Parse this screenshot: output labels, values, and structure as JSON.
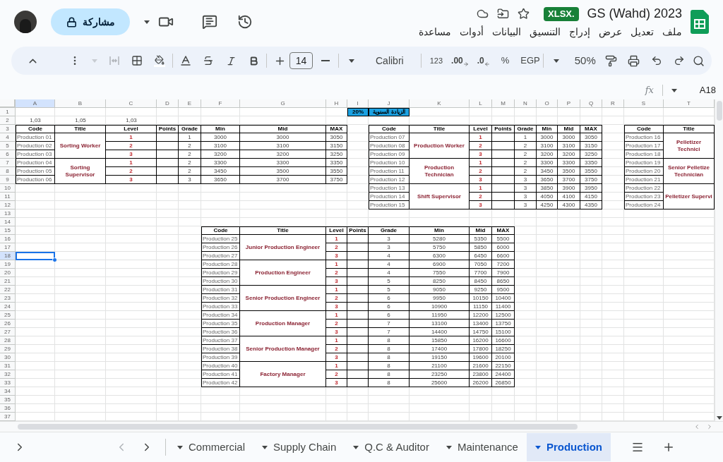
{
  "header": {
    "title": "GS (Wahd) 2023",
    "file_badge": "XLSX.",
    "share_label": "مشاركة",
    "menu": [
      "ملف",
      "تعديل",
      "عرض",
      "إدراج",
      "التنسيق",
      "البيانات",
      "أدوات",
      "مساعدة"
    ]
  },
  "toolbar": {
    "zoom": "50%",
    "currency": "EGP",
    "percent": "%",
    "decimal_more": ".00",
    "decimal_less": ".0",
    "number_format": "123",
    "font": "Calibri",
    "font_size": "14"
  },
  "formula_bar": {
    "fx": "fx",
    "name_box": "A18"
  },
  "grid": {
    "columns": [
      "A",
      "B",
      "C",
      "D",
      "E",
      "F",
      "G",
      "H",
      "I",
      "J",
      "K",
      "L",
      "M",
      "N",
      "O",
      "P",
      "Q",
      "R",
      "S",
      "T"
    ],
    "rows": [
      "1",
      "2",
      "3",
      "4",
      "5",
      "6",
      "7",
      "8",
      "9",
      "10",
      "11",
      "12",
      "13",
      "14",
      "15",
      "16",
      "17",
      "18",
      "19",
      "20",
      "21",
      "22",
      "23",
      "24",
      "25",
      "26",
      "27",
      "28",
      "29",
      "30",
      "31",
      "32",
      "33",
      "34",
      "35",
      "36",
      "37"
    ],
    "cells": [
      {
        "text": "20%",
        "kind": "highlight"
      },
      {
        "text": "الزيادة السنوية",
        "kind": "highlight"
      },
      {
        "text": "1,03",
        "kind": "plain"
      },
      {
        "text": "1,05",
        "kind": "plain"
      },
      {
        "text": "1,03",
        "kind": "plain"
      }
    ],
    "tables": [
      {
        "columns": [
          "Code",
          "Title",
          "Level",
          "Points",
          "Grade",
          "Min",
          "Mid",
          "MAX"
        ],
        "groups": [
          {
            "title": "Sorting Worker",
            "rows": [
              [
                "Production 01",
                "1",
                "1",
                "3000",
                "3000",
                "3050"
              ],
              [
                "Production 02",
                "2",
                "2",
                "3100",
                "3100",
                "3150"
              ],
              [
                "Production 03",
                "3",
                "2",
                "3200",
                "3200",
                "3250"
              ]
            ]
          },
          {
            "title": "Sorting Supervisor",
            "rows": [
              [
                "Production 04",
                "1",
                "2",
                "3300",
                "3300",
                "3350"
              ],
              [
                "Production 05",
                "2",
                "2",
                "3450",
                "3500",
                "3550"
              ],
              [
                "Production 06",
                "3",
                "3",
                "3650",
                "3700",
                "3750"
              ]
            ]
          }
        ]
      },
      {
        "columns": [
          "Code",
          "Title",
          "Level",
          "Points",
          "Grade",
          "Min",
          "Mid",
          "MAX"
        ],
        "groups": [
          {
            "title": "Production Worker",
            "rows": [
              [
                "Production 07",
                "1",
                "1",
                "3000",
                "3000",
                "3050"
              ],
              [
                "Production 08",
                "2",
                "2",
                "3100",
                "3100",
                "3150"
              ],
              [
                "Production 09",
                "3",
                "2",
                "3200",
                "3200",
                "3250"
              ]
            ]
          },
          {
            "title": "Production Technician",
            "rows": [
              [
                "Production 10",
                "1",
                "2",
                "3300",
                "3300",
                "3350"
              ],
              [
                "Production 11",
                "2",
                "2",
                "3450",
                "3500",
                "3550"
              ],
              [
                "Production 12",
                "3",
                "3",
                "3650",
                "3700",
                "3750"
              ]
            ]
          },
          {
            "title": "Shift Supervisor",
            "rows": [
              [
                "Production 13",
                "1",
                "3",
                "3850",
                "3900",
                "3950"
              ],
              [
                "Production 14",
                "2",
                "3",
                "4050",
                "4100",
                "4150"
              ],
              [
                "Production 15",
                "3",
                "3",
                "4250",
                "4300",
                "4350"
              ]
            ]
          }
        ]
      },
      {
        "columns": [
          "Code",
          "Title"
        ],
        "groups": [
          {
            "title": "Pelletizer Technici",
            "rows": [
              [
                "Production 16"
              ],
              [
                "Production 17"
              ],
              [
                "Production 18"
              ]
            ]
          },
          {
            "title": "Senior Pelletize Technician",
            "rows": [
              [
                "Production 19"
              ],
              [
                "Production 20"
              ],
              [
                "Production 21"
              ]
            ]
          },
          {
            "title": "Pelletizer Supervi",
            "rows": [
              [
                "Production 22"
              ],
              [
                "Production 23"
              ],
              [
                "Production 24"
              ]
            ]
          }
        ]
      },
      {
        "columns": [
          "Code",
          "Title",
          "Level",
          "Points",
          "Grade",
          "Min",
          "Mid",
          "MAX"
        ],
        "groups": [
          {
            "title": "Junior Production Engineer",
            "rows": [
              [
                "Production 25",
                "1",
                "3",
                "5280",
                "5350",
                "5500"
              ],
              [
                "Production 26",
                "2",
                "3",
                "5750",
                "5850",
                "6000"
              ],
              [
                "Production 27",
                "3",
                "4",
                "6300",
                "6450",
                "6600"
              ]
            ]
          },
          {
            "title": "Production Engineer",
            "rows": [
              [
                "Production 28",
                "1",
                "4",
                "6900",
                "7050",
                "7200"
              ],
              [
                "Production 29",
                "2",
                "4",
                "7550",
                "7700",
                "7900"
              ],
              [
                "Production 30",
                "3",
                "5",
                "8250",
                "8450",
                "8650"
              ]
            ]
          },
          {
            "title": "Senior Production Engineer",
            "rows": [
              [
                "Production 31",
                "1",
                "5",
                "9050",
                "9250",
                "9500"
              ],
              [
                "Production 32",
                "2",
                "6",
                "9950",
                "10150",
                "10400"
              ],
              [
                "Production 33",
                "3",
                "6",
                "10900",
                "11150",
                "11400"
              ]
            ]
          },
          {
            "title": "Production Manager",
            "rows": [
              [
                "Production 34",
                "1",
                "6",
                "11950",
                "12200",
                "12500"
              ],
              [
                "Production 35",
                "2",
                "7",
                "13100",
                "13400",
                "13750"
              ],
              [
                "Production 36",
                "3",
                "7",
                "14400",
                "14750",
                "15100"
              ]
            ]
          },
          {
            "title": "Senior Production Manager",
            "rows": [
              [
                "Production 37",
                "1",
                "8",
                "15850",
                "16200",
                "16600"
              ],
              [
                "Production 38",
                "2",
                "8",
                "17400",
                "17800",
                "18250"
              ],
              [
                "Production 39",
                "3",
                "8",
                "19150",
                "19600",
                "20100"
              ]
            ]
          },
          {
            "title": "Factory Manager",
            "rows": [
              [
                "Production 40",
                "1",
                "8",
                "21100",
                "21600",
                "22150"
              ],
              [
                "Production 41",
                "2",
                "8",
                "23250",
                "23800",
                "24400"
              ],
              [
                "Production 42",
                "3",
                "8",
                "25600",
                "26200",
                "26850"
              ]
            ]
          }
        ]
      }
    ]
  },
  "sheet_tabs": [
    {
      "label": "Commercial",
      "selected": false
    },
    {
      "label": "Supply Chain",
      "selected": false
    },
    {
      "label": "Q.C & Auditor",
      "selected": false
    },
    {
      "label": "Maintenance",
      "selected": false
    },
    {
      "label": "Production",
      "selected": true
    }
  ]
}
